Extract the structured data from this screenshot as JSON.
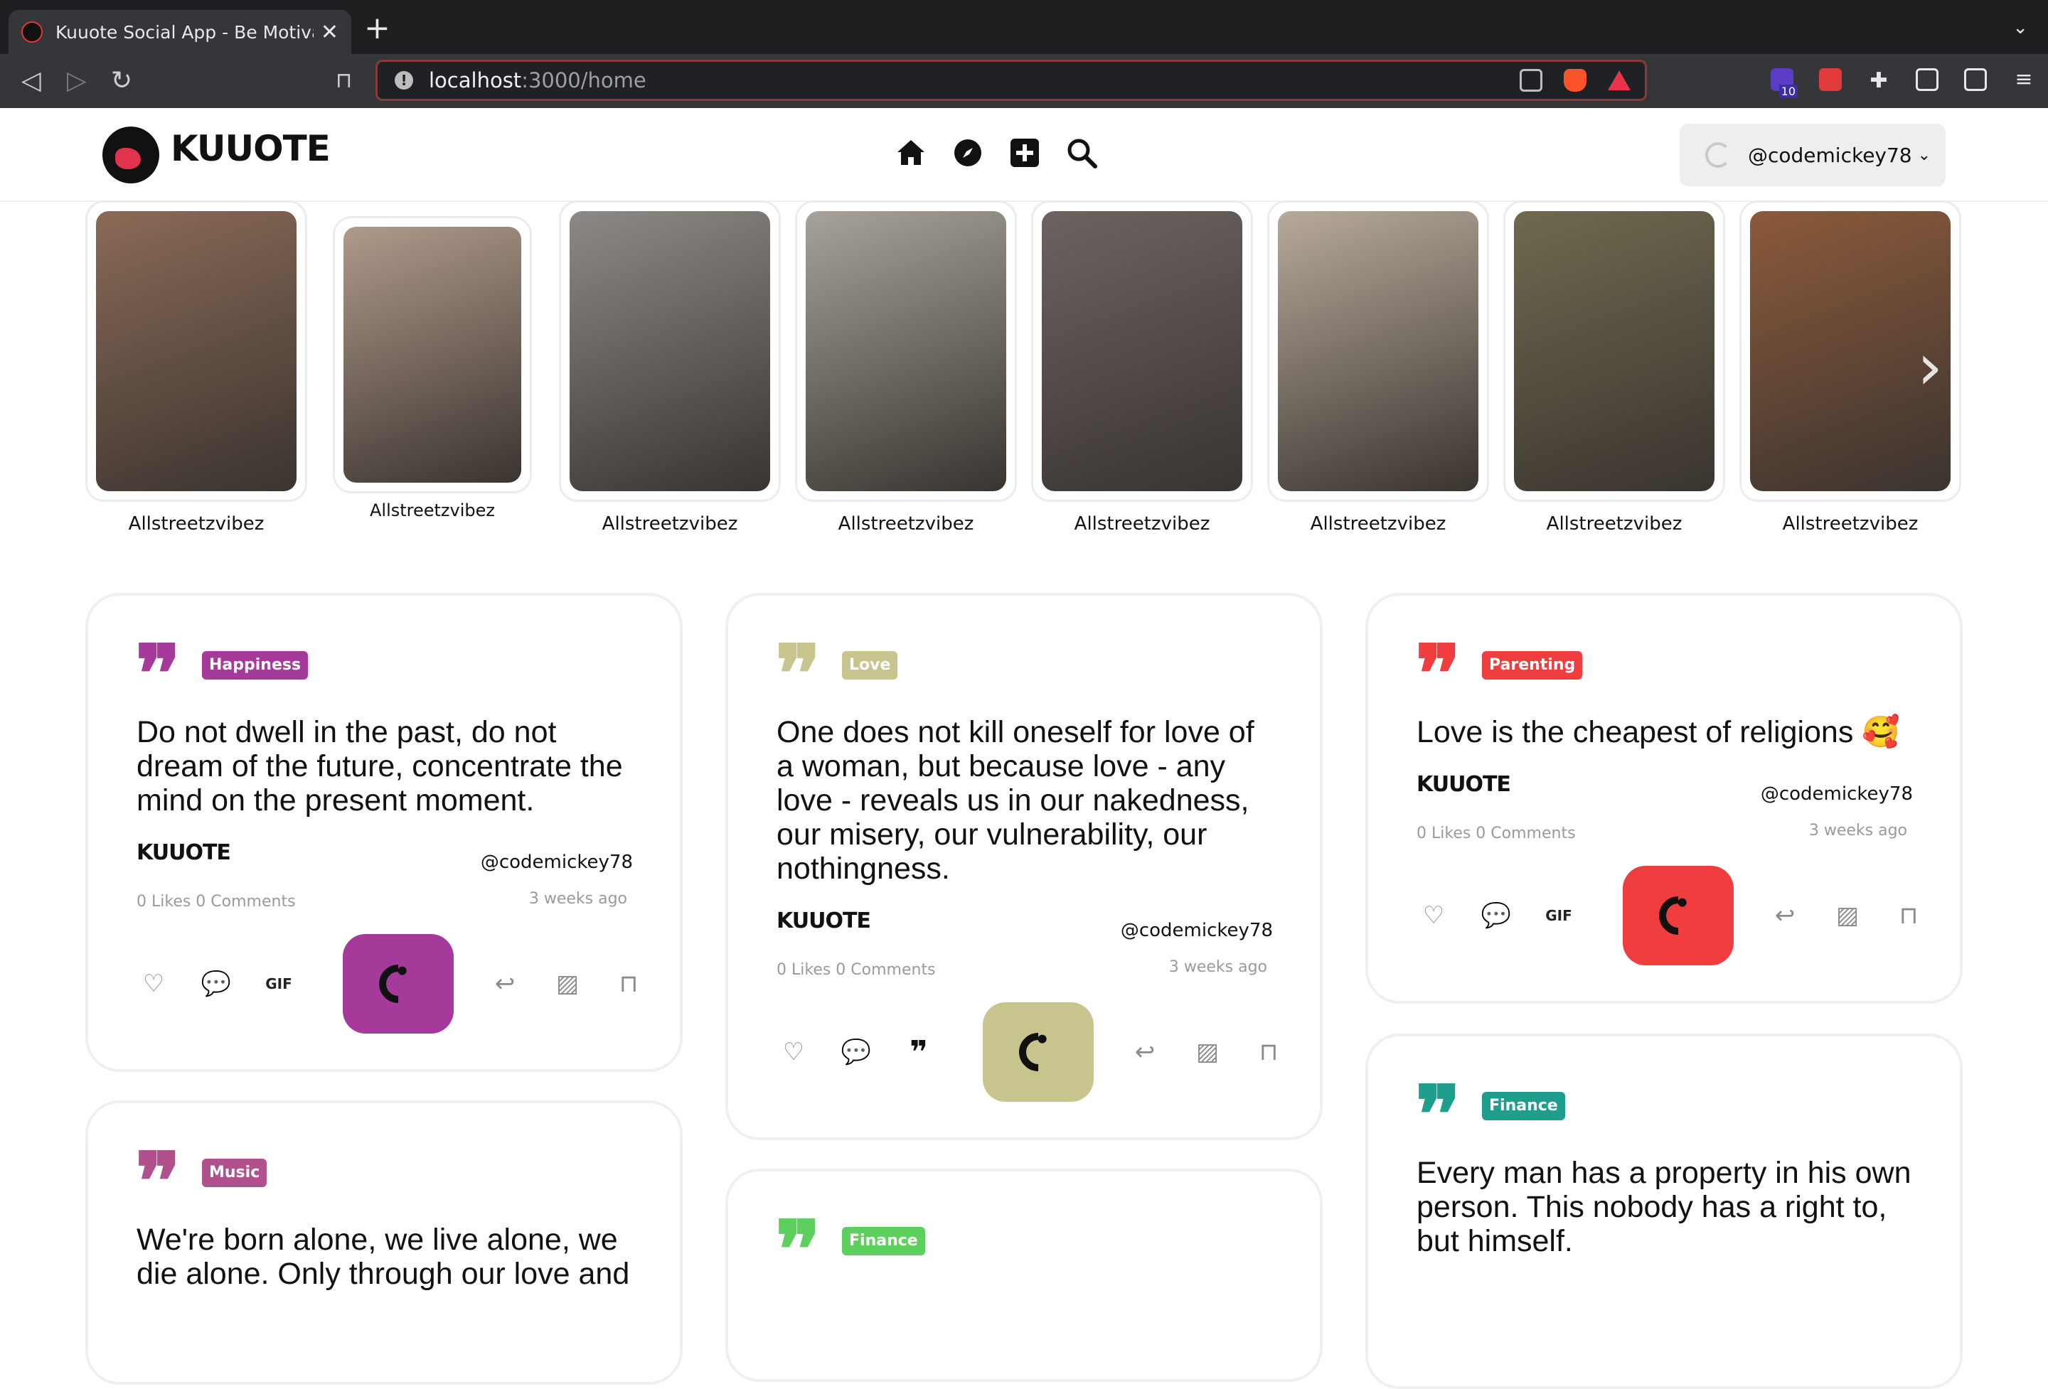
{
  "browser": {
    "tab_title": "Kuuote Social App - Be Motivated",
    "tab_close": "✕",
    "new_tab": "+",
    "url_host": "localhost",
    "url_path": ":3000/home",
    "ext_badge": "10"
  },
  "app": {
    "logo_text": "KUUOTE",
    "user_handle": "@codemickey78",
    "user_chevron": "⌄"
  },
  "stories": [
    {
      "name": "Allstreetzvibez",
      "color": "#8a6a56"
    },
    {
      "name": "Allstreetzvibez",
      "color": "#b09a8a"
    },
    {
      "name": "Allstreetzvibez",
      "color": "#8d8a86"
    },
    {
      "name": "Allstreetzvibez",
      "color": "#a8a29c"
    },
    {
      "name": "Allstreetzvibez",
      "color": "#6b6460"
    },
    {
      "name": "Allstreetzvibez",
      "color": "#b7aa9a"
    },
    {
      "name": "Allstreetzvibez",
      "color": "#6f6a4e"
    },
    {
      "name": "Allstreetzvibez",
      "color": "#8c5a3a"
    }
  ],
  "cards": [
    {
      "tag": "Happiness",
      "accent": "#a63a9a",
      "text": "Do not dwell in the past, do not dream of the future, concentrate the mind on the present moment.",
      "brand": "KUUOTE",
      "user": "@codemickey78",
      "stats": "0 Likes 0 Comments",
      "time": "3 weeks ago",
      "third_action": "GIF"
    },
    {
      "tag": "Love",
      "accent": "#c8c48e",
      "text": "One does not kill oneself for love of a woman, but because love - any love - reveals us in our nakedness, our misery, our vulnerability, our nothingness.",
      "brand": "KUUOTE",
      "user": "@codemickey78",
      "stats": "0 Likes 0 Comments",
      "time": "3 weeks ago",
      "third_action": "❞"
    },
    {
      "tag": "Parenting",
      "accent": "#f03d3d",
      "text": "Love is the cheapest of religions 🥰",
      "brand": "KUUOTE",
      "user": "@codemickey78",
      "stats": "0 Likes 0 Comments",
      "time": "3 weeks ago",
      "third_action": "GIF"
    },
    {
      "tag": "Music",
      "accent": "#b0508c",
      "text": "We're born alone, we live alone, we die alone. Only through our love and"
    },
    {
      "tag": "Finance",
      "accent": "#5ccf5c",
      "text": ""
    },
    {
      "tag": "Finance",
      "accent": "#1f9e8e",
      "text": "Every man has a property in his own person. This nobody has a right to, but himself."
    }
  ]
}
